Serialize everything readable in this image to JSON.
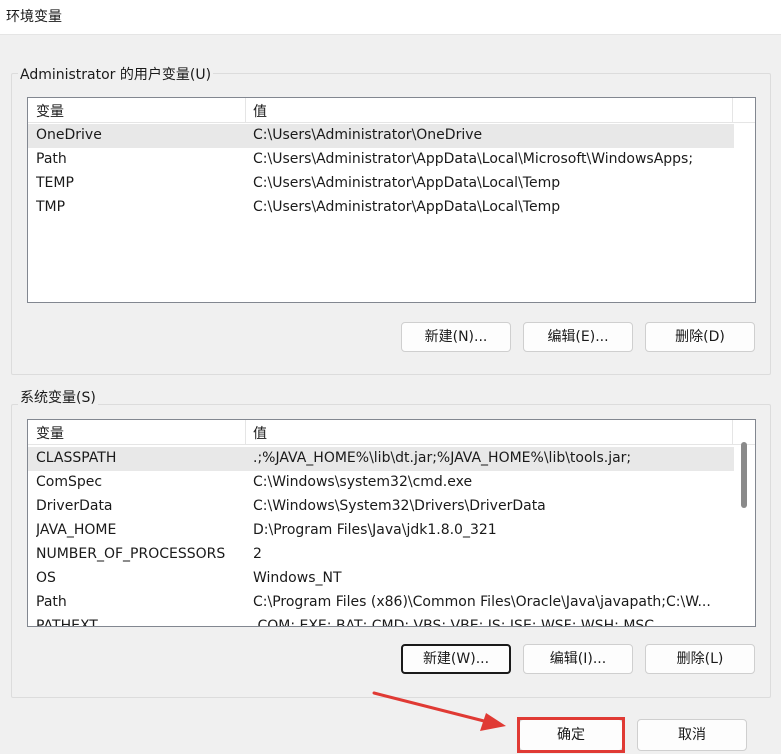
{
  "window": {
    "title": "环境变量"
  },
  "user_vars": {
    "group_label": "Administrator 的用户变量(U)",
    "columns": [
      "变量",
      "值"
    ],
    "rows": [
      {
        "name": "OneDrive",
        "value": "C:\\Users\\Administrator\\OneDrive"
      },
      {
        "name": "Path",
        "value": "C:\\Users\\Administrator\\AppData\\Local\\Microsoft\\WindowsApps;"
      },
      {
        "name": "TEMP",
        "value": "C:\\Users\\Administrator\\AppData\\Local\\Temp"
      },
      {
        "name": "TMP",
        "value": "C:\\Users\\Administrator\\AppData\\Local\\Temp"
      }
    ],
    "buttons": {
      "new": "新建(N)...",
      "edit": "编辑(E)...",
      "delete": "删除(D)"
    }
  },
  "system_vars": {
    "group_label": "系统变量(S)",
    "columns": [
      "变量",
      "值"
    ],
    "rows": [
      {
        "name": "CLASSPATH",
        "value": ".;%JAVA_HOME%\\lib\\dt.jar;%JAVA_HOME%\\lib\\tools.jar;"
      },
      {
        "name": "ComSpec",
        "value": "C:\\Windows\\system32\\cmd.exe"
      },
      {
        "name": "DriverData",
        "value": "C:\\Windows\\System32\\Drivers\\DriverData"
      },
      {
        "name": "JAVA_HOME",
        "value": "D:\\Program Files\\Java\\jdk1.8.0_321"
      },
      {
        "name": "NUMBER_OF_PROCESSORS",
        "value": "2"
      },
      {
        "name": "OS",
        "value": "Windows_NT"
      },
      {
        "name": "Path",
        "value": "C:\\Program Files (x86)\\Common Files\\Oracle\\Java\\javapath;C:\\W..."
      },
      {
        "name": "PATHEXT",
        "value": ".COM;.EXE;.BAT;.CMD;.VBS;.VBE;.JS;.JSE;.WSF;.WSH;.MSC"
      }
    ],
    "buttons": {
      "new": "新建(W)...",
      "edit": "编辑(I)...",
      "delete": "删除(L)"
    }
  },
  "footer": {
    "ok": "确定",
    "cancel": "取消"
  },
  "colors": {
    "annotation": "#e03a34",
    "selected_row": "#e8e8e8"
  }
}
